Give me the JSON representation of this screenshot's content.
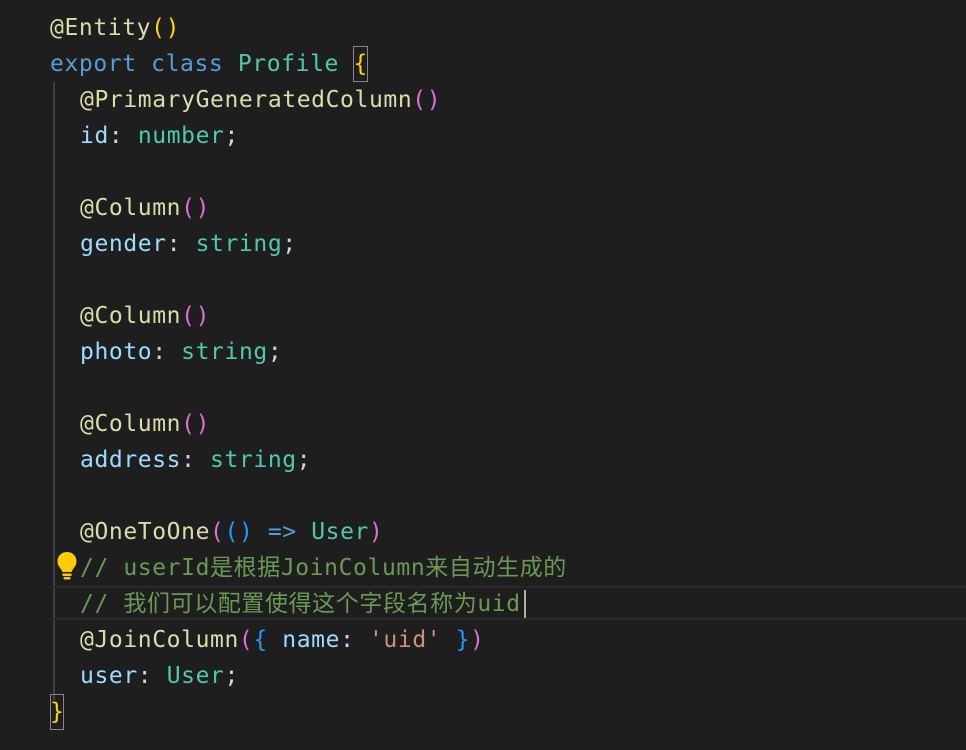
{
  "editor": {
    "lines": [
      {
        "parts": [
          "@Entity",
          "(",
          ")"
        ]
      },
      {
        "parts": [
          "export",
          " ",
          "class",
          " ",
          "Profile",
          " ",
          "{"
        ]
      },
      {
        "parts": [
          "@PrimaryGeneratedColumn",
          "(",
          ")"
        ]
      },
      {
        "parts": [
          "id",
          ": ",
          "number",
          ";"
        ]
      },
      {
        "parts": []
      },
      {
        "parts": [
          "@Column",
          "(",
          ")"
        ]
      },
      {
        "parts": [
          "gender",
          ": ",
          "string",
          ";"
        ]
      },
      {
        "parts": []
      },
      {
        "parts": [
          "@Column",
          "(",
          ")"
        ]
      },
      {
        "parts": [
          "photo",
          ": ",
          "string",
          ";"
        ]
      },
      {
        "parts": []
      },
      {
        "parts": [
          "@Column",
          "(",
          ")"
        ]
      },
      {
        "parts": [
          "address",
          ": ",
          "string",
          ";"
        ]
      },
      {
        "parts": []
      },
      {
        "parts": [
          "@OneToOne",
          "(",
          "(",
          ")",
          " => ",
          "User",
          ")"
        ]
      },
      {
        "parts": [
          "// userId是根据JoinColumn来自动生成的"
        ]
      },
      {
        "parts": [
          "// 我们可以配置使得这个字段名称为uid"
        ]
      },
      {
        "parts": [
          "@JoinColumn",
          "(",
          "{",
          " ",
          "name",
          ": ",
          "'uid'",
          " ",
          "}",
          ")"
        ]
      },
      {
        "parts": [
          "user",
          ": ",
          "User",
          ";"
        ]
      },
      {
        "parts": [
          "}"
        ]
      }
    ]
  },
  "icons": {
    "lightbulb": "lightbulb-icon"
  },
  "colors": {
    "background": "#1e1e1e",
    "keyword": "#569cd6",
    "decorator": "#dcdcaa",
    "class_name": "#4ec9b0",
    "property": "#9cdcfe",
    "comment": "#6a9955",
    "string": "#ce9178",
    "bracket_level1": "#ffd700",
    "bracket_level2": "#da70d6",
    "bracket_level3": "#179fff",
    "lightbulb": "#ffcc00"
  }
}
